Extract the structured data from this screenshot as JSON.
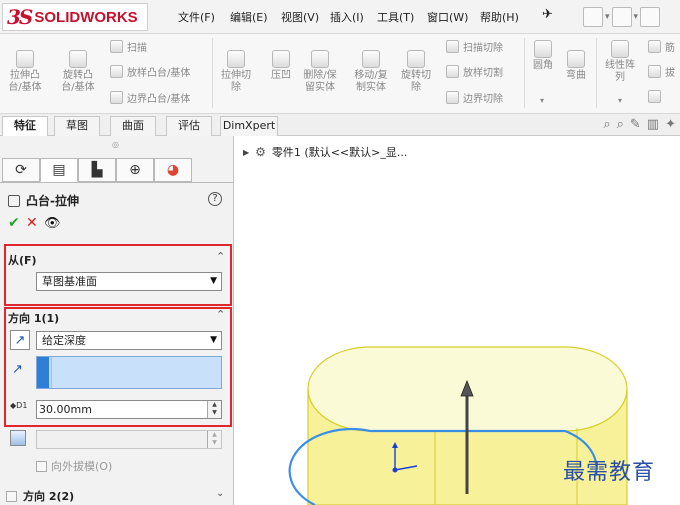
{
  "brand": {
    "logo_mark": "3S",
    "logo_text": "SOLIDWORKS"
  },
  "menu": [
    "文件(F)",
    "编辑(E)",
    "视图(V)",
    "插入(I)",
    "工具(T)",
    "窗口(W)",
    "帮助(H)"
  ],
  "ribbon": {
    "extrude_boss": "拉伸凸\n台/基体",
    "revolve_boss": "旋转凸\n台/基体",
    "sweep": "扫描",
    "loft_boss": "放样凸台/基体",
    "boundary_boss": "边界凸台/基体",
    "extrude_cut": "拉伸切\n除",
    "hole": "压凹",
    "delete_keep": "删除/保\n留实体",
    "move_copy": "移动/复\n制实体",
    "revolve_cut": "旋转切\n除",
    "sweep_cut": "扫描切除",
    "loft_cut": "放样切割",
    "boundary_cut": "边界切除",
    "fillet": "圆角",
    "flex": "弯曲",
    "linear_pattern": "线性阵\n列",
    "rib": "筋",
    "draft": "拔"
  },
  "command_tabs": [
    "特征",
    "草图",
    "曲面",
    "评估",
    "DimXpert"
  ],
  "property_manager": {
    "title": "凸台-拉伸",
    "from_section": {
      "label": "从(F)",
      "value": "草图基准面"
    },
    "direction1": {
      "label": "方向 1(1)",
      "end_condition": "给定深度",
      "depth": "30.00mm",
      "draft_outward_label": "向外拔模(O)"
    },
    "direction2": {
      "label": "方向 2(2)"
    }
  },
  "feature_tree": {
    "root": "零件1  (默认<<默认>_显..."
  },
  "watermark": "最需教育",
  "colors": {
    "brand_red": "#c8102e",
    "highlight_red": "#e0262e",
    "selection_blue": "#bcd9f7",
    "model_yellow": "#f7f29a",
    "sketch_blue": "#3a8ee6"
  }
}
